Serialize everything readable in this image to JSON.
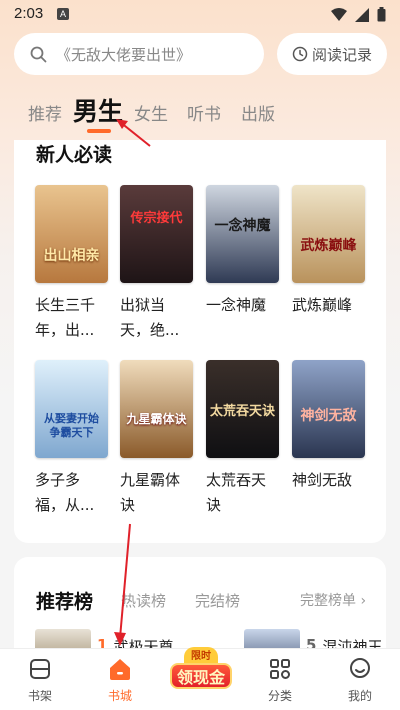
{
  "status_bar": {
    "time": "2:03",
    "notification_badge": "A"
  },
  "search": {
    "placeholder": "《无敌大佬要出世》",
    "history_label": "阅读记录"
  },
  "tabs": [
    {
      "label": "推荐",
      "active": false
    },
    {
      "label": "男生",
      "active": true
    },
    {
      "label": "女生",
      "active": false
    },
    {
      "label": "听书",
      "active": false
    },
    {
      "label": "出版",
      "active": false
    }
  ],
  "new_reader": {
    "title": "新人必读",
    "books": [
      {
        "title_line1": "长生三千",
        "title_line2": "年，出...",
        "cover_text": "出山相亲",
        "cover_color": "#d9a46a"
      },
      {
        "title_line1": "出狱当",
        "title_line2": "天，绝...",
        "cover_text": "传宗接代",
        "cover_color": "#3a2a2a"
      },
      {
        "title_line1": "一念神魔",
        "title_line2": "",
        "cover_text": "一念神魔",
        "cover_color": "#3c4a66"
      },
      {
        "title_line1": "武炼巅峰",
        "title_line2": "",
        "cover_text": "武炼巅峰",
        "cover_color": "#d8c6a0"
      },
      {
        "title_line1": "多子多",
        "title_line2": "福，从...",
        "cover_text": "从娶妻开始争霸天下",
        "cover_color": "#8fb5d6"
      },
      {
        "title_line1": "九星霸体",
        "title_line2": "诀",
        "cover_text": "九星霸体诀",
        "cover_color": "#c9a06c"
      },
      {
        "title_line1": "太荒吞天",
        "title_line2": "诀",
        "cover_text": "太荒吞天诀",
        "cover_color": "#2b2a2e"
      },
      {
        "title_line1": "神剑无敌",
        "title_line2": "",
        "cover_text": "神剑无敌",
        "cover_color": "#4a5f86"
      }
    ]
  },
  "ranking": {
    "title": "推荐榜",
    "tabs": [
      "热读榜",
      "完结榜"
    ],
    "more_label": "完整榜单",
    "items": [
      {
        "rank": "1",
        "name": "武极天尊",
        "rank_color": "#ff6a2a"
      },
      {
        "rank": "5",
        "name": "混沌神王",
        "rank_color": "#666666"
      }
    ]
  },
  "bottom_nav": {
    "items": [
      {
        "label": "书架",
        "icon": "bookshelf-icon"
      },
      {
        "label": "书城",
        "icon": "home-icon",
        "active": true
      },
      {
        "label": "领现金",
        "icon": "cash-reward-icon"
      },
      {
        "label": "分类",
        "icon": "category-icon"
      },
      {
        "label": "我的",
        "icon": "profile-icon"
      }
    ],
    "promo_badge_top": "限时"
  },
  "colors": {
    "accent": "#ff6a2a",
    "annotation_arrow": "#e0212a"
  }
}
